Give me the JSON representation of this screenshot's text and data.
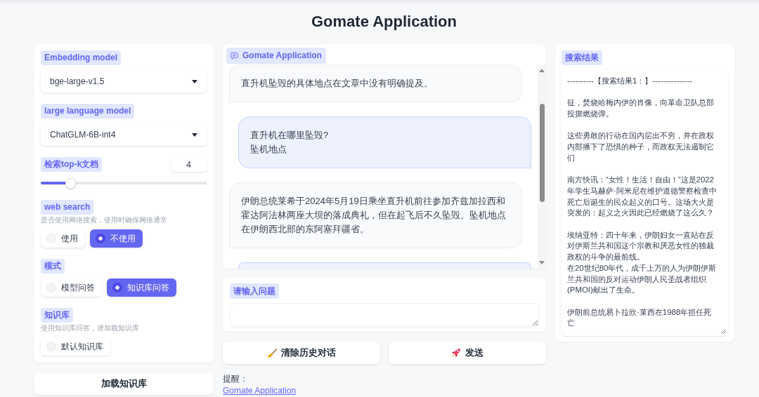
{
  "title": "Gomate Application",
  "settings": [
    {
      "kind": "dropdown",
      "label": "Embedding model",
      "value": "bge-large-v1.5"
    },
    {
      "kind": "dropdown",
      "label": "large language model",
      "value": "ChatGLM-6B-int4"
    },
    {
      "kind": "slider",
      "label": "检索top-k文档",
      "value": "4",
      "level": 0.18
    },
    {
      "kind": "radio",
      "label": "web search",
      "info": "是否使用网络搜索，使用时确保网络通常",
      "options": [
        {
          "label": "使用",
          "selected": false
        },
        {
          "label": "不使用",
          "selected": true
        }
      ]
    },
    {
      "kind": "radio",
      "label": "模式",
      "options": [
        {
          "label": "模型问答",
          "selected": false
        },
        {
          "label": "知识库问答",
          "selected": true
        }
      ]
    },
    {
      "kind": "radio",
      "label": "知识库",
      "info": "使用知识库问答，请加载知识库",
      "options": [
        {
          "label": "默认知识库",
          "selected": false
        }
      ]
    }
  ],
  "load_button": {
    "label": "加载知识库"
  },
  "chat": {
    "label": "Gomate Application",
    "messages": [
      {
        "kind": "bot",
        "text": "直升机坠毁的具体地点在文章中没有明确提及。"
      },
      {
        "kind": "user",
        "lines": [
          "直升机在哪里坠毁?",
          "坠机地点"
        ]
      },
      {
        "kind": "bot",
        "text": "伊朗总统莱希于2024年5月19日乘坐直升机前往参加齐兹加拉西和霍达阿法林两座大坝的落成典礼，但在起飞后不久坠毁。坠机地点在伊朗西北部的东阿塞拜疆省。"
      },
      {
        "kind": "user"
      }
    ]
  },
  "question": {
    "label": "请输入问题"
  },
  "actions": [
    {
      "kind": "clear",
      "label": "清除历史对话"
    },
    {
      "kind": "send",
      "label": "发送"
    }
  ],
  "notice": {
    "text": "提醒：",
    "link": "Gomate Application"
  },
  "search_results": {
    "label": "搜索结果",
    "sections": [
      {
        "lines": [
          "----------【搜索结果1：】---------------"
        ]
      },
      {
        "lines": [
          "征，焚烧哈梅内伊的肖像，向革命卫队总部投掷燃烧弹。"
        ]
      },
      {
        "lines": [
          "这些勇敢的行动在国内层出不穷，并在政权内部播下了恐惧的种子，而政权无法遏制它们"
        ]
      },
      {
        "lines": [
          "南方快讯：“女性！生活！自由！”这是2022年学生马赫萨·阿米尼在维护道德警察检查中死亡后诞生的民众起义的口号。这场大火是突发的：起义之火因此已经燃烧了这么久？"
        ]
      },
      {
        "lines": [
          "埃纳亚特：四十年来，伊朗妇女一直站在反对伊斯兰共和国这个宗教和厌恶女性的独裁政权的斗争的最前线。",
          "在20世纪80年代，成千上万的人为伊朗伊斯兰共和国的反对运动伊朗人民圣战者组织(PMOI)献出了生命。"
        ]
      },
      {
        "lines": [
          "伊朗前总统易卜拉欣·莱西在1988年担任死亡"
        ]
      }
    ]
  }
}
